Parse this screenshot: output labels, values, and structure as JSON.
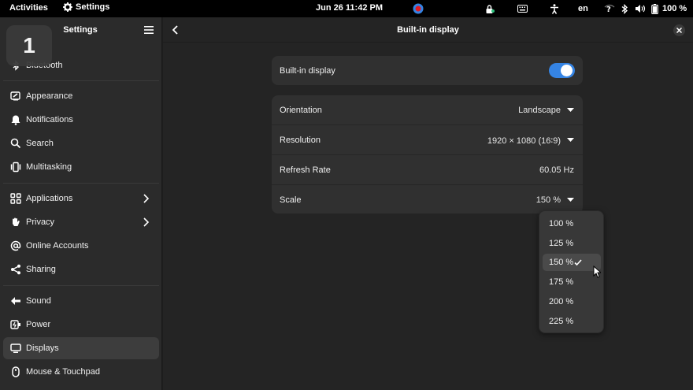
{
  "topbar": {
    "activities": "Activities",
    "app_name": "Settings",
    "clock": "Jun 26  11:42 PM",
    "keyboard_layout": "en",
    "battery": "100 %"
  },
  "workspace": {
    "number": "1"
  },
  "sidebar": {
    "title": "Settings",
    "items": [
      {
        "label": "Bluetooth",
        "icon": "bluetooth-icon"
      },
      {
        "label": "Appearance",
        "icon": "appearance-icon"
      },
      {
        "label": "Notifications",
        "icon": "bell-icon"
      },
      {
        "label": "Search",
        "icon": "search-icon"
      },
      {
        "label": "Multitasking",
        "icon": "multitasking-icon"
      },
      {
        "label": "Applications",
        "icon": "apps-grid-icon"
      },
      {
        "label": "Privacy",
        "icon": "hand-icon"
      },
      {
        "label": "Online Accounts",
        "icon": "at-icon"
      },
      {
        "label": "Sharing",
        "icon": "share-icon"
      },
      {
        "label": "Sound",
        "icon": "speaker-icon"
      },
      {
        "label": "Power",
        "icon": "power-icon"
      },
      {
        "label": "Displays",
        "icon": "display-icon"
      },
      {
        "label": "Mouse & Touchpad",
        "icon": "mouse-icon"
      }
    ]
  },
  "content": {
    "title": "Built-in display",
    "builtin_display": {
      "label": "Built-in display",
      "enabled": true
    },
    "orientation": {
      "label": "Orientation",
      "value": "Landscape"
    },
    "resolution": {
      "label": "Resolution",
      "value": "1920 × 1080 (16∶9)"
    },
    "refresh_rate": {
      "label": "Refresh Rate",
      "value": "60.05 Hz"
    },
    "scale": {
      "label": "Scale",
      "value": "150 %"
    }
  },
  "scale_popover": {
    "options": [
      "100 %",
      "125 %",
      "150 %",
      "175 %",
      "200 %",
      "225 %"
    ],
    "selected": "150 %"
  },
  "colors": {
    "accent": "#3584e4",
    "window_bg": "#242424",
    "sidebar_bg": "#2b2b2b",
    "card_bg": "#303030",
    "topbar_bg": "#000000"
  }
}
